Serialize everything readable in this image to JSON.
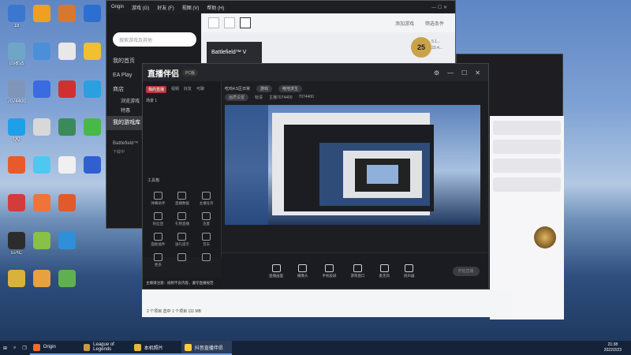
{
  "desktop": {
    "icons": [
      {
        "name": "18",
        "color": "#3b77d0"
      },
      {
        "name": "回收站",
        "color": "#6fa6c8"
      },
      {
        "name": "7074400",
        "color": "#8096b8"
      },
      {
        "name": "QQ",
        "color": "#1ea0e8"
      },
      {
        "name": "",
        "color": "#e85a2a"
      },
      {
        "name": "",
        "color": "#d43b3b"
      },
      {
        "name": "EPIC",
        "color": "#2c2c2c"
      },
      {
        "name": "",
        "color": "#d8b23a"
      },
      {
        "name": "",
        "color": "#f0a020"
      },
      {
        "name": "",
        "color": "#4b8fd8"
      },
      {
        "name": "",
        "color": "#3a6be0"
      },
      {
        "name": "",
        "color": "#d8d8d8"
      },
      {
        "name": "",
        "color": "#4fc8f0"
      },
      {
        "name": "",
        "color": "#f0733a"
      },
      {
        "name": "",
        "color": "#88c048"
      },
      {
        "name": "",
        "color": "#e8a040"
      },
      {
        "name": "",
        "color": "#d87830"
      },
      {
        "name": "",
        "color": "#e8e8e8"
      },
      {
        "name": "",
        "color": "#d03030"
      },
      {
        "name": "",
        "color": "#3a8a5c"
      },
      {
        "name": "",
        "color": "#f0f0f0"
      },
      {
        "name": "",
        "color": "#e05a2a"
      },
      {
        "name": "",
        "color": "#2f8fd8"
      },
      {
        "name": "",
        "color": "#60b050"
      },
      {
        "name": "",
        "color": "#2d6fd0"
      },
      {
        "name": "",
        "color": "#f0c030"
      },
      {
        "name": "",
        "color": "#2aa0e0"
      },
      {
        "name": "",
        "color": "#48b848"
      },
      {
        "name": "",
        "color": "#3060d0"
      }
    ]
  },
  "origin": {
    "title": "Origin",
    "menu": [
      "Origin",
      "游戏 (G)",
      "好友 (F)",
      "视图 (V)",
      "帮助 (H)"
    ],
    "search_placeholder": "搜索游戏及其他",
    "nav": [
      "我的首页",
      "EA Play",
      "商店",
      "我的游戏库"
    ],
    "sub": [
      "浏览游戏",
      "特惠"
    ],
    "tile": "Battlefield™ V",
    "toolbar_right": [
      "添加游戏",
      "筛选条件"
    ],
    "badge": "25",
    "badge_info": [
      "5.1...",
      "23.4..."
    ],
    "user_label": "下载中",
    "side_item": "Battlefield™"
  },
  "live": {
    "logo": "直播伴侣",
    "version": "PC版",
    "tabs": [
      "我的直播",
      "视频",
      "好友",
      "可聊"
    ],
    "scene": "场景 1",
    "tools_label": "工具箱",
    "tools": [
      "弹幕助手",
      "直播数据",
      "主播任务",
      "粉丝团",
      "礼物直播",
      "连麦",
      "面板插件",
      "送礼提示",
      "音乐",
      "更多",
      "",
      ""
    ],
    "header_items": [
      "吃鸡4.5区日常",
      "游戏",
      "绝地求生"
    ],
    "header_row2": [
      "画质设置",
      "标清",
      "主播7074400",
      "7074400"
    ],
    "bottom": [
      "直播画面",
      "摄像头",
      "手机投屏",
      "游戏窗口",
      "麦克风",
      "扬声器"
    ],
    "start_btn": "开始直播",
    "notice": "主播请注意：抵制不良内容，遵守直播规范"
  },
  "explorer": {
    "status": "2 个项目  选中 1 个项目  111 MB"
  },
  "taskbar": {
    "tasks": [
      "Origin",
      "League of Legends",
      "本机照片",
      "抖音直播伴侣"
    ],
    "time": "21:38",
    "date": "2022/2/23"
  }
}
